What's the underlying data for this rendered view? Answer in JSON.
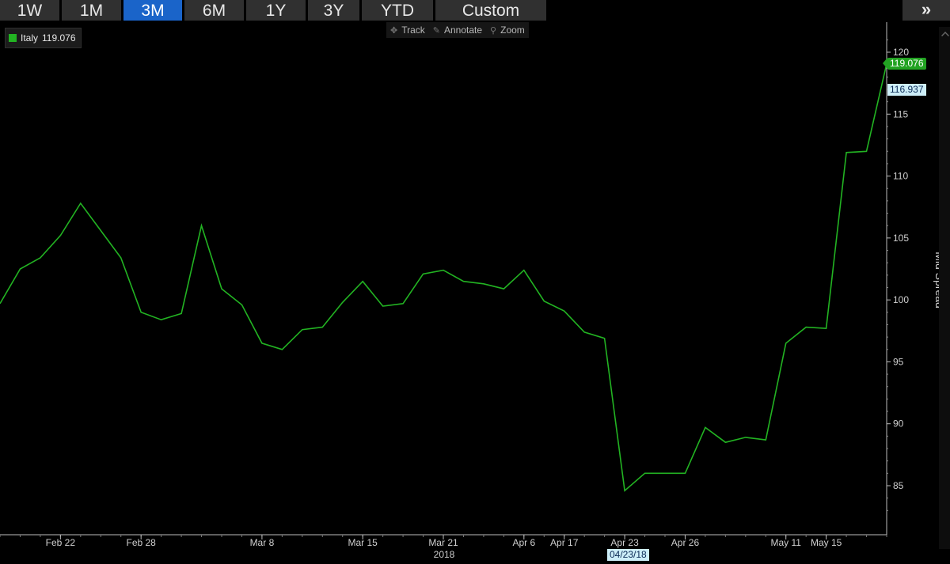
{
  "toolbar": {
    "tabs": [
      {
        "label": "1W",
        "active": false
      },
      {
        "label": "1M",
        "active": false
      },
      {
        "label": "3M",
        "active": true
      },
      {
        "label": "6M",
        "active": false
      },
      {
        "label": "1Y",
        "active": false
      },
      {
        "label": "3Y",
        "active": false
      },
      {
        "label": "YTD",
        "active": false
      },
      {
        "label": "Custom",
        "active": false
      }
    ],
    "more_label": "»"
  },
  "legend": {
    "series_name": "Italy",
    "last_value": "119.076",
    "color": "#22b322"
  },
  "tools": [
    {
      "icon": "crosshair-icon",
      "label": "Track"
    },
    {
      "icon": "pencil-icon",
      "label": "Annotate"
    },
    {
      "icon": "magnifier-icon",
      "label": "Zoom"
    }
  ],
  "tags": {
    "last_value": "119.076",
    "cursor_value": "116.937",
    "cursor_date": "04/23/18"
  },
  "chart_data": {
    "type": "line",
    "ylabel": "Mid Spread",
    "ylim": [
      82,
      122
    ],
    "yticks": [
      85,
      90,
      95,
      100,
      105,
      110,
      115,
      120
    ],
    "year_label": "2018",
    "grid": false,
    "legend": "top-left",
    "background": "#000000",
    "xticks": [
      {
        "label": "Feb 22",
        "index": 3
      },
      {
        "label": "Feb 28",
        "index": 7
      },
      {
        "label": "Mar 8",
        "index": 13
      },
      {
        "label": "Mar 15",
        "index": 18
      },
      {
        "label": "Mar 21",
        "index": 22
      },
      {
        "label": "Apr 6",
        "index": 26
      },
      {
        "label": "Apr 17",
        "index": 28
      },
      {
        "label": "Apr 23",
        "index": 31
      },
      {
        "label": "Apr 26",
        "index": 34
      },
      {
        "label": "May 11",
        "index": 39
      },
      {
        "label": "May 15",
        "index": 41
      }
    ],
    "series": [
      {
        "name": "Italy",
        "color": "#22b322",
        "values": [
          99.7,
          102.5,
          103.4,
          105.2,
          107.8,
          105.6,
          103.4,
          99.0,
          98.4,
          98.9,
          106.0,
          100.9,
          99.6,
          96.5,
          96.0,
          97.6,
          97.8,
          99.8,
          101.5,
          99.5,
          99.7,
          102.1,
          102.4,
          101.5,
          101.3,
          100.9,
          102.4,
          99.9,
          99.1,
          97.4,
          96.9,
          84.6,
          86.0,
          86.0,
          86.0,
          89.7,
          88.5,
          88.9,
          88.7,
          96.5,
          97.8,
          97.7,
          111.9,
          112.0,
          119.076
        ]
      }
    ]
  }
}
